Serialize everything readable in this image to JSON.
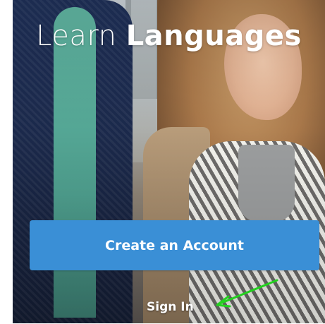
{
  "title": {
    "light": "Learn ",
    "bold": "Languages"
  },
  "primary_button": {
    "label": "Create an Account"
  },
  "secondary_link": {
    "label": "Sign In"
  },
  "colors": {
    "primary_button": "#3a8fd6",
    "text": "#ffffff",
    "annotation_arrow": "#22d11e"
  }
}
